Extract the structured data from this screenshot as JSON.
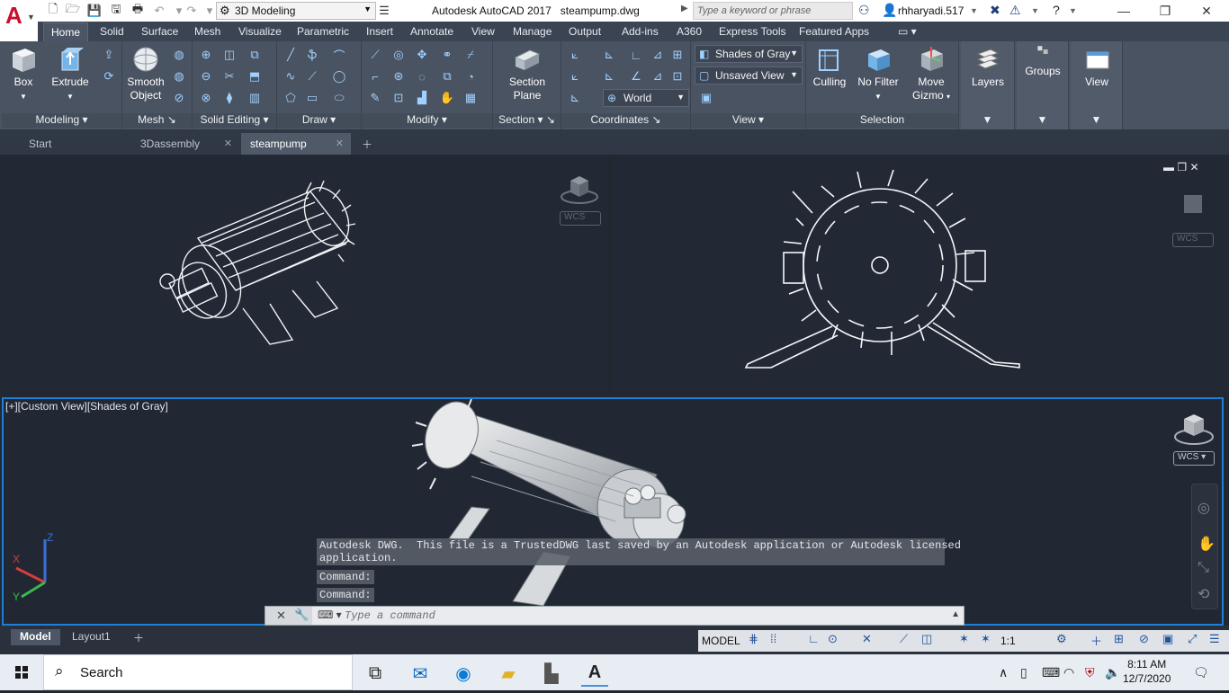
{
  "titlebar": {
    "workspace": "3D Modeling",
    "app_title": "Autodesk AutoCAD 2017",
    "file_name": "steampump.dwg",
    "search_placeholder": "Type a keyword or phrase",
    "user": "rhharyadi.517"
  },
  "ribbon_tabs": [
    "Home",
    "Solid",
    "Surface",
    "Mesh",
    "Visualize",
    "Parametric",
    "Insert",
    "Annotate",
    "View",
    "Manage",
    "Output",
    "Add-ins",
    "A360",
    "Express Tools",
    "Featured Apps"
  ],
  "ribbon": {
    "modeling": {
      "title": "Modeling",
      "box": "Box",
      "extrude": "Extrude"
    },
    "mesh": {
      "title": "Mesh",
      "smooth_object": "Smooth Object"
    },
    "solid_editing": {
      "title": "Solid Editing"
    },
    "draw": {
      "title": "Draw"
    },
    "modify": {
      "title": "Modify"
    },
    "section": {
      "title": "Section",
      "section_plane": "Section Plane"
    },
    "coordinates": {
      "title": "Coordinates",
      "ucs": "World"
    },
    "view": {
      "title": "View",
      "visual_style": "Shades of Gray",
      "named_view": "Unsaved View"
    },
    "selection": {
      "title": "Selection",
      "culling": "Culling",
      "no_filter": "No Filter",
      "move_gizmo": "Move Gizmo"
    },
    "layers": "Layers",
    "groups": "Groups",
    "view_btn": "View"
  },
  "file_tabs": [
    "Start",
    "3Dassembly",
    "steampump"
  ],
  "viewport": {
    "label": "[+][Custom View][Shades of Gray]",
    "wcs": "WCS"
  },
  "command": {
    "history_1": "Autodesk DWG.  This file is a TrustedDWG last saved by an Autodesk application or Autodesk licensed\napplication.",
    "history_2": "Command:",
    "history_3": "Command:",
    "placeholder": "Type a command"
  },
  "layout_tabs": [
    "Model",
    "Layout1"
  ],
  "status": {
    "model": "MODEL",
    "scale": "1:1"
  },
  "taskbar": {
    "search": "Search",
    "time": "8:11 AM",
    "date": "12/7/2020"
  }
}
